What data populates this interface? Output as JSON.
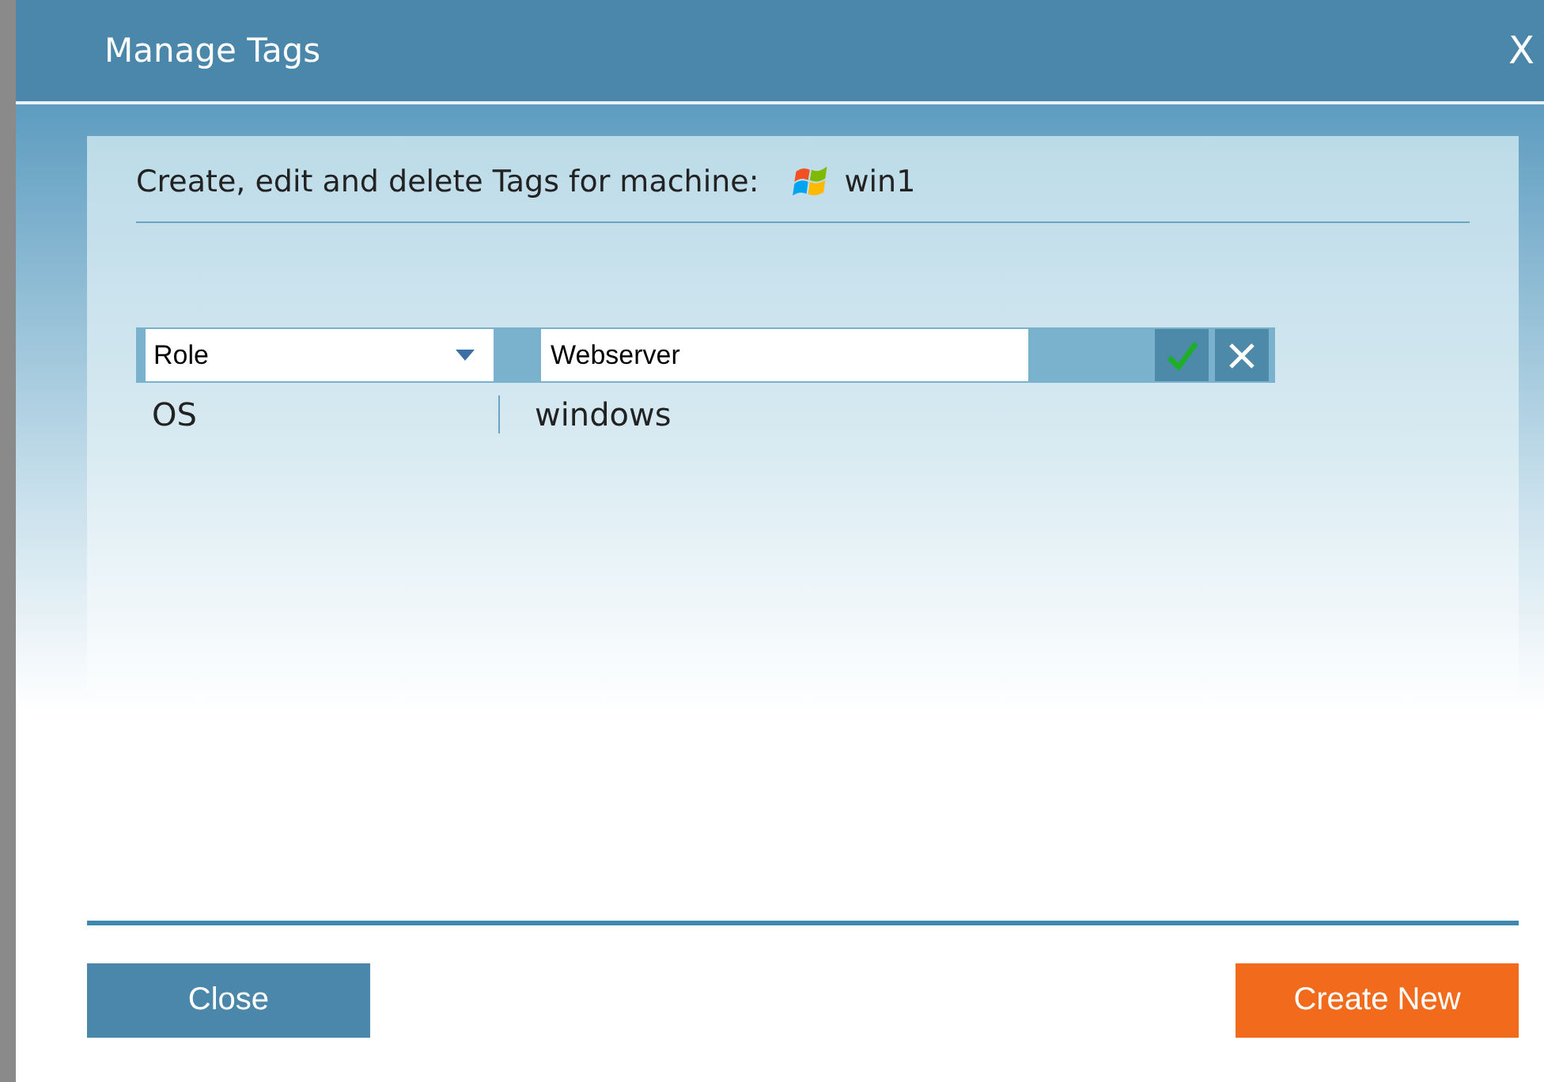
{
  "window": {
    "title": "Manage Tags",
    "close_icon": "X"
  },
  "heading": {
    "text": "Create, edit and delete Tags for machine:",
    "machine": "win1"
  },
  "edit_row": {
    "key": "Role",
    "value": "Webserver"
  },
  "tags": [
    {
      "key": "OS",
      "value": "windows"
    }
  ],
  "buttons": [
    {
      "label": "Close",
      "kind": "secondary"
    },
    {
      "label": "Create New",
      "kind": "primary"
    }
  ]
}
